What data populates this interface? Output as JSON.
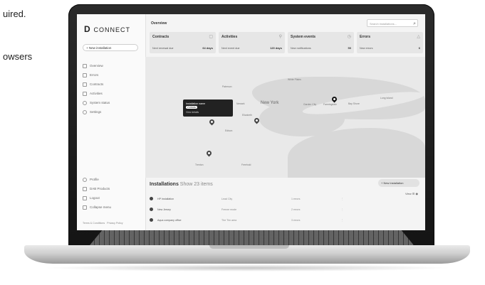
{
  "caption": {
    "line1": "uired.",
    "line2": "owsers"
  },
  "sidebar": {
    "logo_mark": "D",
    "logo_text": "CONNECT",
    "new_installation": "+ New installation",
    "items": [
      {
        "label": "Overview",
        "icon": "grid-icon"
      },
      {
        "label": "Errors",
        "icon": "warning-icon"
      },
      {
        "label": "Contracts",
        "icon": "document-icon"
      },
      {
        "label": "Activities",
        "icon": "wrench-icon"
      },
      {
        "label": "System status",
        "icon": "pulse-icon"
      },
      {
        "label": "Settings",
        "icon": "gear-icon"
      }
    ],
    "bottom_items": [
      {
        "label": "Profile",
        "icon": "user-icon"
      },
      {
        "label": "DAB Products",
        "icon": "box-icon"
      },
      {
        "label": "Logout",
        "icon": "logout-icon"
      },
      {
        "label": "Collapse menu",
        "icon": "collapse-icon"
      }
    ],
    "terms": "Terms & Conditions",
    "privacy": "Privacy Policy"
  },
  "header": {
    "title": "Overview",
    "search_placeholder": "Search installations..."
  },
  "cards": [
    {
      "title": "Contracts",
      "label": "Next renewal due",
      "value": "64 days",
      "icon": "document-icon"
    },
    {
      "title": "Activities",
      "label": "Next event due",
      "value": "120 days",
      "icon": "wrench-icon"
    },
    {
      "title": "System events",
      "label": "New notifications",
      "value": "50",
      "icon": "clock-icon"
    },
    {
      "title": "Errors",
      "label": "New errors",
      "value": "6",
      "icon": "warning-icon"
    }
  ],
  "map": {
    "labels": [
      "New York",
      "White Plains",
      "Garden City",
      "Farmingdale",
      "Bay Shore",
      "Long Island",
      "Paterson",
      "Newark",
      "Elizabeth",
      "Edison",
      "Trenton",
      "Freehold"
    ],
    "popup": {
      "name": "Installation name",
      "badge": "2 errors",
      "link": "View details"
    }
  },
  "installations": {
    "title": "Installations",
    "show": "Show 23 items",
    "new_button": "+ New installation",
    "view_label": "View",
    "rows": [
      {
        "name": "HP Installation",
        "location": "Lead City",
        "status": "1 errors"
      },
      {
        "name": "New Jersey",
        "location": "Freeze mode",
        "status": "2 errors"
      },
      {
        "name": "Aqua company office",
        "location": "The Tim area",
        "status": "3 errors"
      }
    ]
  }
}
